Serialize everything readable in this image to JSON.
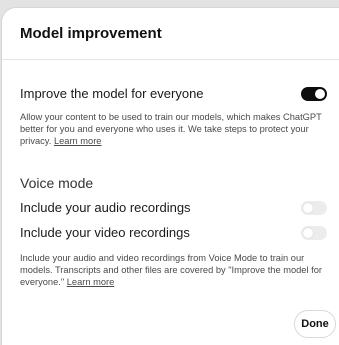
{
  "dialog": {
    "title": "Model improvement",
    "improve": {
      "label": "Improve the model for everyone",
      "enabled": true,
      "description": "Allow your content to be used to train our models, which makes ChatGPT better for you and everyone who uses it. We take steps to protect your privacy.",
      "learn_more": "Learn more"
    },
    "voice_mode": {
      "title": "Voice mode",
      "audio": {
        "label": "Include your audio recordings",
        "enabled": false
      },
      "video": {
        "label": "Include your video recordings",
        "enabled": false
      },
      "description": "Include your audio and video recordings from Voice Mode to train our models. Transcripts and other files are covered by \"Improve the model for everyone.\"",
      "learn_more": "Learn more"
    },
    "done_label": "Done"
  }
}
